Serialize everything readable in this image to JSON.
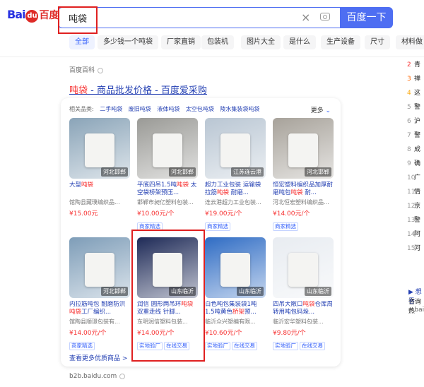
{
  "brand": {
    "logo_bai": "Bai",
    "logo_du": "du",
    "logo_baidu": "百度"
  },
  "search": {
    "query": "吨袋",
    "button": "百度一下",
    "clear_icon": "×"
  },
  "tabs": [
    {
      "label": "全部",
      "active": true
    },
    {
      "label": "多少钱一个吨袋",
      "active": false
    },
    {
      "label": "厂家直销",
      "active": false
    },
    {
      "label": "包装机",
      "active": false
    },
    {
      "label": "图片大全",
      "active": false
    },
    {
      "label": "是什么",
      "active": false
    },
    {
      "label": "生产设备",
      "active": false
    },
    {
      "label": "尺寸",
      "active": false
    },
    {
      "label": "材料做",
      "active": false
    }
  ],
  "baike": {
    "label": "百度百科"
  },
  "result": {
    "title_kw": "吨袋",
    "title_rest": " - 商品批发价格 - 百度爱采购",
    "related_label": "相关品类:",
    "related": [
      "二手吨袋",
      "废旧吨袋",
      "液体吨袋",
      "太空包吨袋",
      "陵水集装袋吨袋"
    ],
    "more": "更多",
    "see_more": "查看更多优质商品 >",
    "source": "b2b.baidu.com"
  },
  "products": [
    {
      "name_kw": "大型",
      "name_kw2": "吨袋",
      "name_rest": "",
      "seller": "馆陶县藏璞编织品...",
      "price": "¥15.00元",
      "badges": [],
      "tag": "河北邯郸",
      "bg": "#8aa4b8"
    },
    {
      "name_kw": "平底四吊1.5吨",
      "name_kw2": "吨袋",
      "name_rest": " 太空袋桥架预压...",
      "seller": "邯郸市昶亿塑料包装...",
      "price": "¥10.00元/个",
      "badges": [
        "商家精选"
      ],
      "tag": "河北邯郸",
      "bg": "#9a9a96"
    },
    {
      "name_kw": "超力工业包装 运输袋拉筋",
      "name_kw2": "吨袋",
      "name_rest": " 耐磨...",
      "seller": "连云港超力工业包装...",
      "price": "¥19.00元/个",
      "badges": [
        "商家精选"
      ],
      "tag": "江苏连云港",
      "bg": "#b9c6d3"
    },
    {
      "name_kw": "恒宏塑料编织品加厚耐磨吨包",
      "name_kw2": "吨袋",
      "name_rest": " 耐...",
      "seller": "河北恒宏塑料编织品...",
      "price": "¥14.00元/个",
      "badges": [
        "商家精选"
      ],
      "tag": "河北邯郸",
      "bg": "#a7a29a"
    },
    {
      "name_kw": "内拉筋吨包 耐磨防洪",
      "name_kw2": "吨袋",
      "name_rest": "工厂编织...",
      "seller": "馆陶县顺璟包装有...",
      "price": "¥14.00元/个",
      "badges": [
        "商家精选"
      ],
      "tag": "河北邯郸",
      "bg": "#7e9db8"
    },
    {
      "name_kw": "润信 圆形两吊环",
      "name_kw2": "吨袋",
      "name_rest": " 双重走线 针脚...",
      "seller": "东明润信塑料包装...",
      "price": "¥14.00元/个",
      "badges": [
        "实地验厂",
        "在线交易"
      ],
      "tag": "山东临沂",
      "bg": "#1e2a57"
    },
    {
      "name_kw": "白色吨包集装袋1吨1.5吨黄色",
      "name_kw2": "桥架",
      "name_rest": "预...",
      "seller": "临沂众兴塑编有限...",
      "price": "¥10.60元/个",
      "badges": [
        "实地验厂",
        "在线交易"
      ],
      "tag": "山东临沂",
      "bg": "#2f6cc4"
    },
    {
      "name_kw": "四吊大敞口",
      "name_kw2": "吨袋",
      "name_rest": "仓库周转用吨包码垛...",
      "seller": "临沂宏华塑料包装...",
      "price": "¥9.80元/个",
      "badges": [
        "实地验厂",
        "在线交易"
      ],
      "tag": "山东临沂",
      "bg": "#e8ecf1"
    }
  ],
  "right_list": [
    {
      "num": "2",
      "text": "青"
    },
    {
      "num": "3",
      "text": "禅"
    },
    {
      "num": "4",
      "text": "这"
    },
    {
      "num": "5",
      "text": "警"
    },
    {
      "num": "6",
      "text": "沪"
    },
    {
      "num": "7",
      "text": "警"
    },
    {
      "num": "8",
      "text": "成"
    },
    {
      "num": "9",
      "text": "确"
    },
    {
      "num": "10",
      "text": "广"
    },
    {
      "num": "11",
      "text": "情"
    },
    {
      "num": "12",
      "text": "京"
    },
    {
      "num": "13",
      "text": "警"
    },
    {
      "num": "14",
      "text": "阿"
    },
    {
      "num": "15",
      "text": "河"
    }
  ],
  "right_bottom": {
    "line1": "▶ 想看",
    "line2": "咨询热",
    "line3": "e.baidu"
  }
}
